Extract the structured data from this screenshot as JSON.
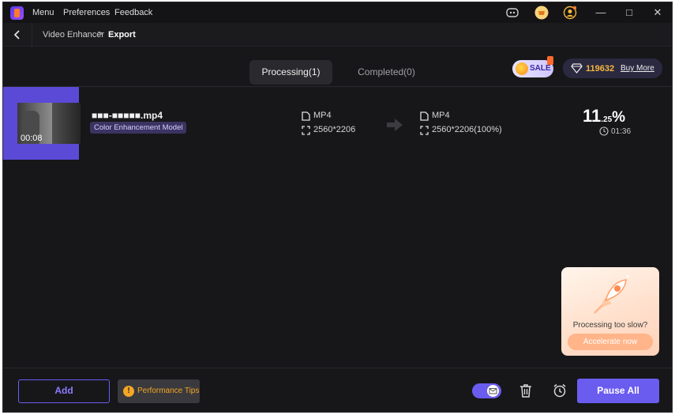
{
  "titlebar": {
    "menus": [
      "Menu",
      "Preferences",
      "Feedback"
    ],
    "icons": [
      "discord-icon",
      "shop-icon",
      "account-icon"
    ],
    "window_controls": [
      "minimize-icon",
      "maximize-icon",
      "close-icon"
    ]
  },
  "breadcrumb": {
    "parent": "Video Enhancer",
    "separator": ">",
    "current": "Export"
  },
  "tabs": [
    {
      "label": "Processing(1)",
      "active": true
    },
    {
      "label": "Completed(0)",
      "active": false
    }
  ],
  "sale": {
    "label": "SALE"
  },
  "credits": {
    "value": "119632",
    "buy_label": "Buy More"
  },
  "task": {
    "duration": "00:08",
    "file_name": "■■■-■■■■■.mp4",
    "model": "Color Enhancement Model",
    "input": {
      "format": "MP4",
      "resolution": "2560*2206"
    },
    "output": {
      "format": "MP4",
      "resolution": "2560*2206(100%)"
    },
    "progress_int": "11",
    "progress_dec": ".25",
    "progress_unit": "%",
    "progress_fraction": 0.1125,
    "time_left": "01:36"
  },
  "promo": {
    "text": "Processing too slow?",
    "button": "Accelerate now"
  },
  "footer": {
    "add_label": "Add",
    "perf_label": "Performance Tips",
    "pause_label": "Pause All",
    "notify_toggle_on": true
  },
  "colors": {
    "accent": "#6b5cf0",
    "background": "#17171a",
    "credits_gold": "#f5b83c",
    "tip_orange": "#f5a623"
  }
}
